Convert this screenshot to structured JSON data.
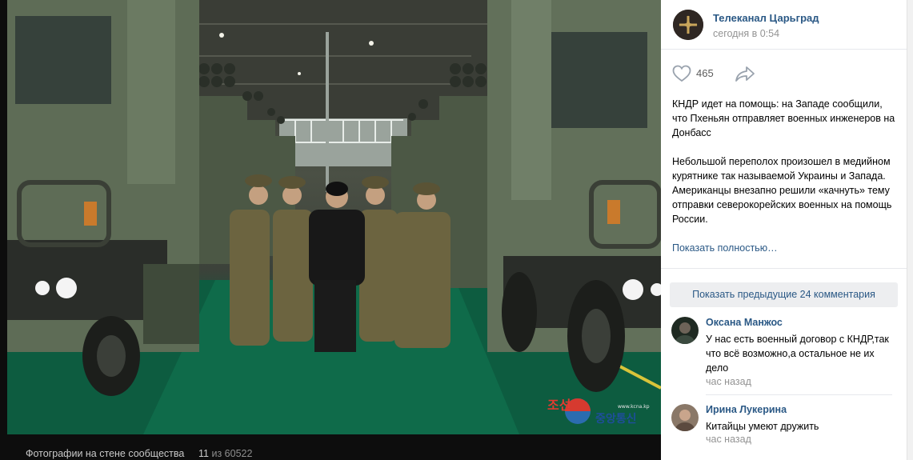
{
  "viewer": {
    "album_label": "Фотографии на стене сообщества",
    "counter_current": "11",
    "counter_sep": "из",
    "counter_total": "60522",
    "watermark_top": "조선",
    "watermark_bottom": "중앙통신",
    "watermark_small": "www.kcna.kp"
  },
  "post": {
    "group_name": "Телеканал Царьград",
    "time": "сегодня в 0:54",
    "likes": "465",
    "paragraph1": "КНДР идет на помощь: на Западе сообщили, что Пхеньян отправляет военных инженеров на Донбасс",
    "paragraph2": "Небольшой переполох произошел в медийном курятнике так называемой Украины и Запада. Американцы внезапно решили «качнуть» тему отправки северокорейских военных на помощь России.",
    "show_full": "Показать полностью…"
  },
  "comments": {
    "show_previous": "Показать предыдущие 24 комментария",
    "items": [
      {
        "author": "Оксана Манжос",
        "text": "У нас есть военный договор с КНДР,так что всё возможно,а остальное не их дело",
        "time": "час назад"
      },
      {
        "author": "Ирина Лукерина",
        "text": "Китайцы умеют дружить",
        "time": "час назад"
      }
    ]
  },
  "colors": {
    "link": "#2a5885",
    "muted": "#939393",
    "button_bg": "#edeef0"
  },
  "icons": [
    "heart-icon",
    "share-arrow-icon",
    "group-avatar",
    "user-avatar"
  ]
}
